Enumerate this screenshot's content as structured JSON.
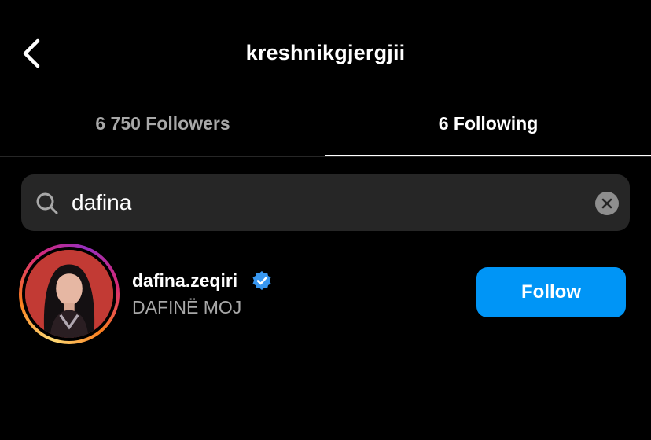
{
  "header": {
    "title": "kreshnikgjergjii",
    "back_icon": "chevron-left-icon"
  },
  "tabs": [
    {
      "label": "6 750 Followers",
      "active": false
    },
    {
      "label": "6 Following",
      "active": true
    }
  ],
  "search": {
    "value": "dafina",
    "icon": "search-icon",
    "clear_icon": "clear-icon"
  },
  "results": [
    {
      "username": "dafina.zeqiri",
      "verified": true,
      "full_name": "DAFINË MOJ",
      "button_label": "Follow"
    }
  ],
  "colors": {
    "background": "#000000",
    "search_bg": "#262626",
    "secondary_text": "#a8a8a8",
    "follow_button": "#0095f6",
    "verified_badge": "#3897f0"
  }
}
